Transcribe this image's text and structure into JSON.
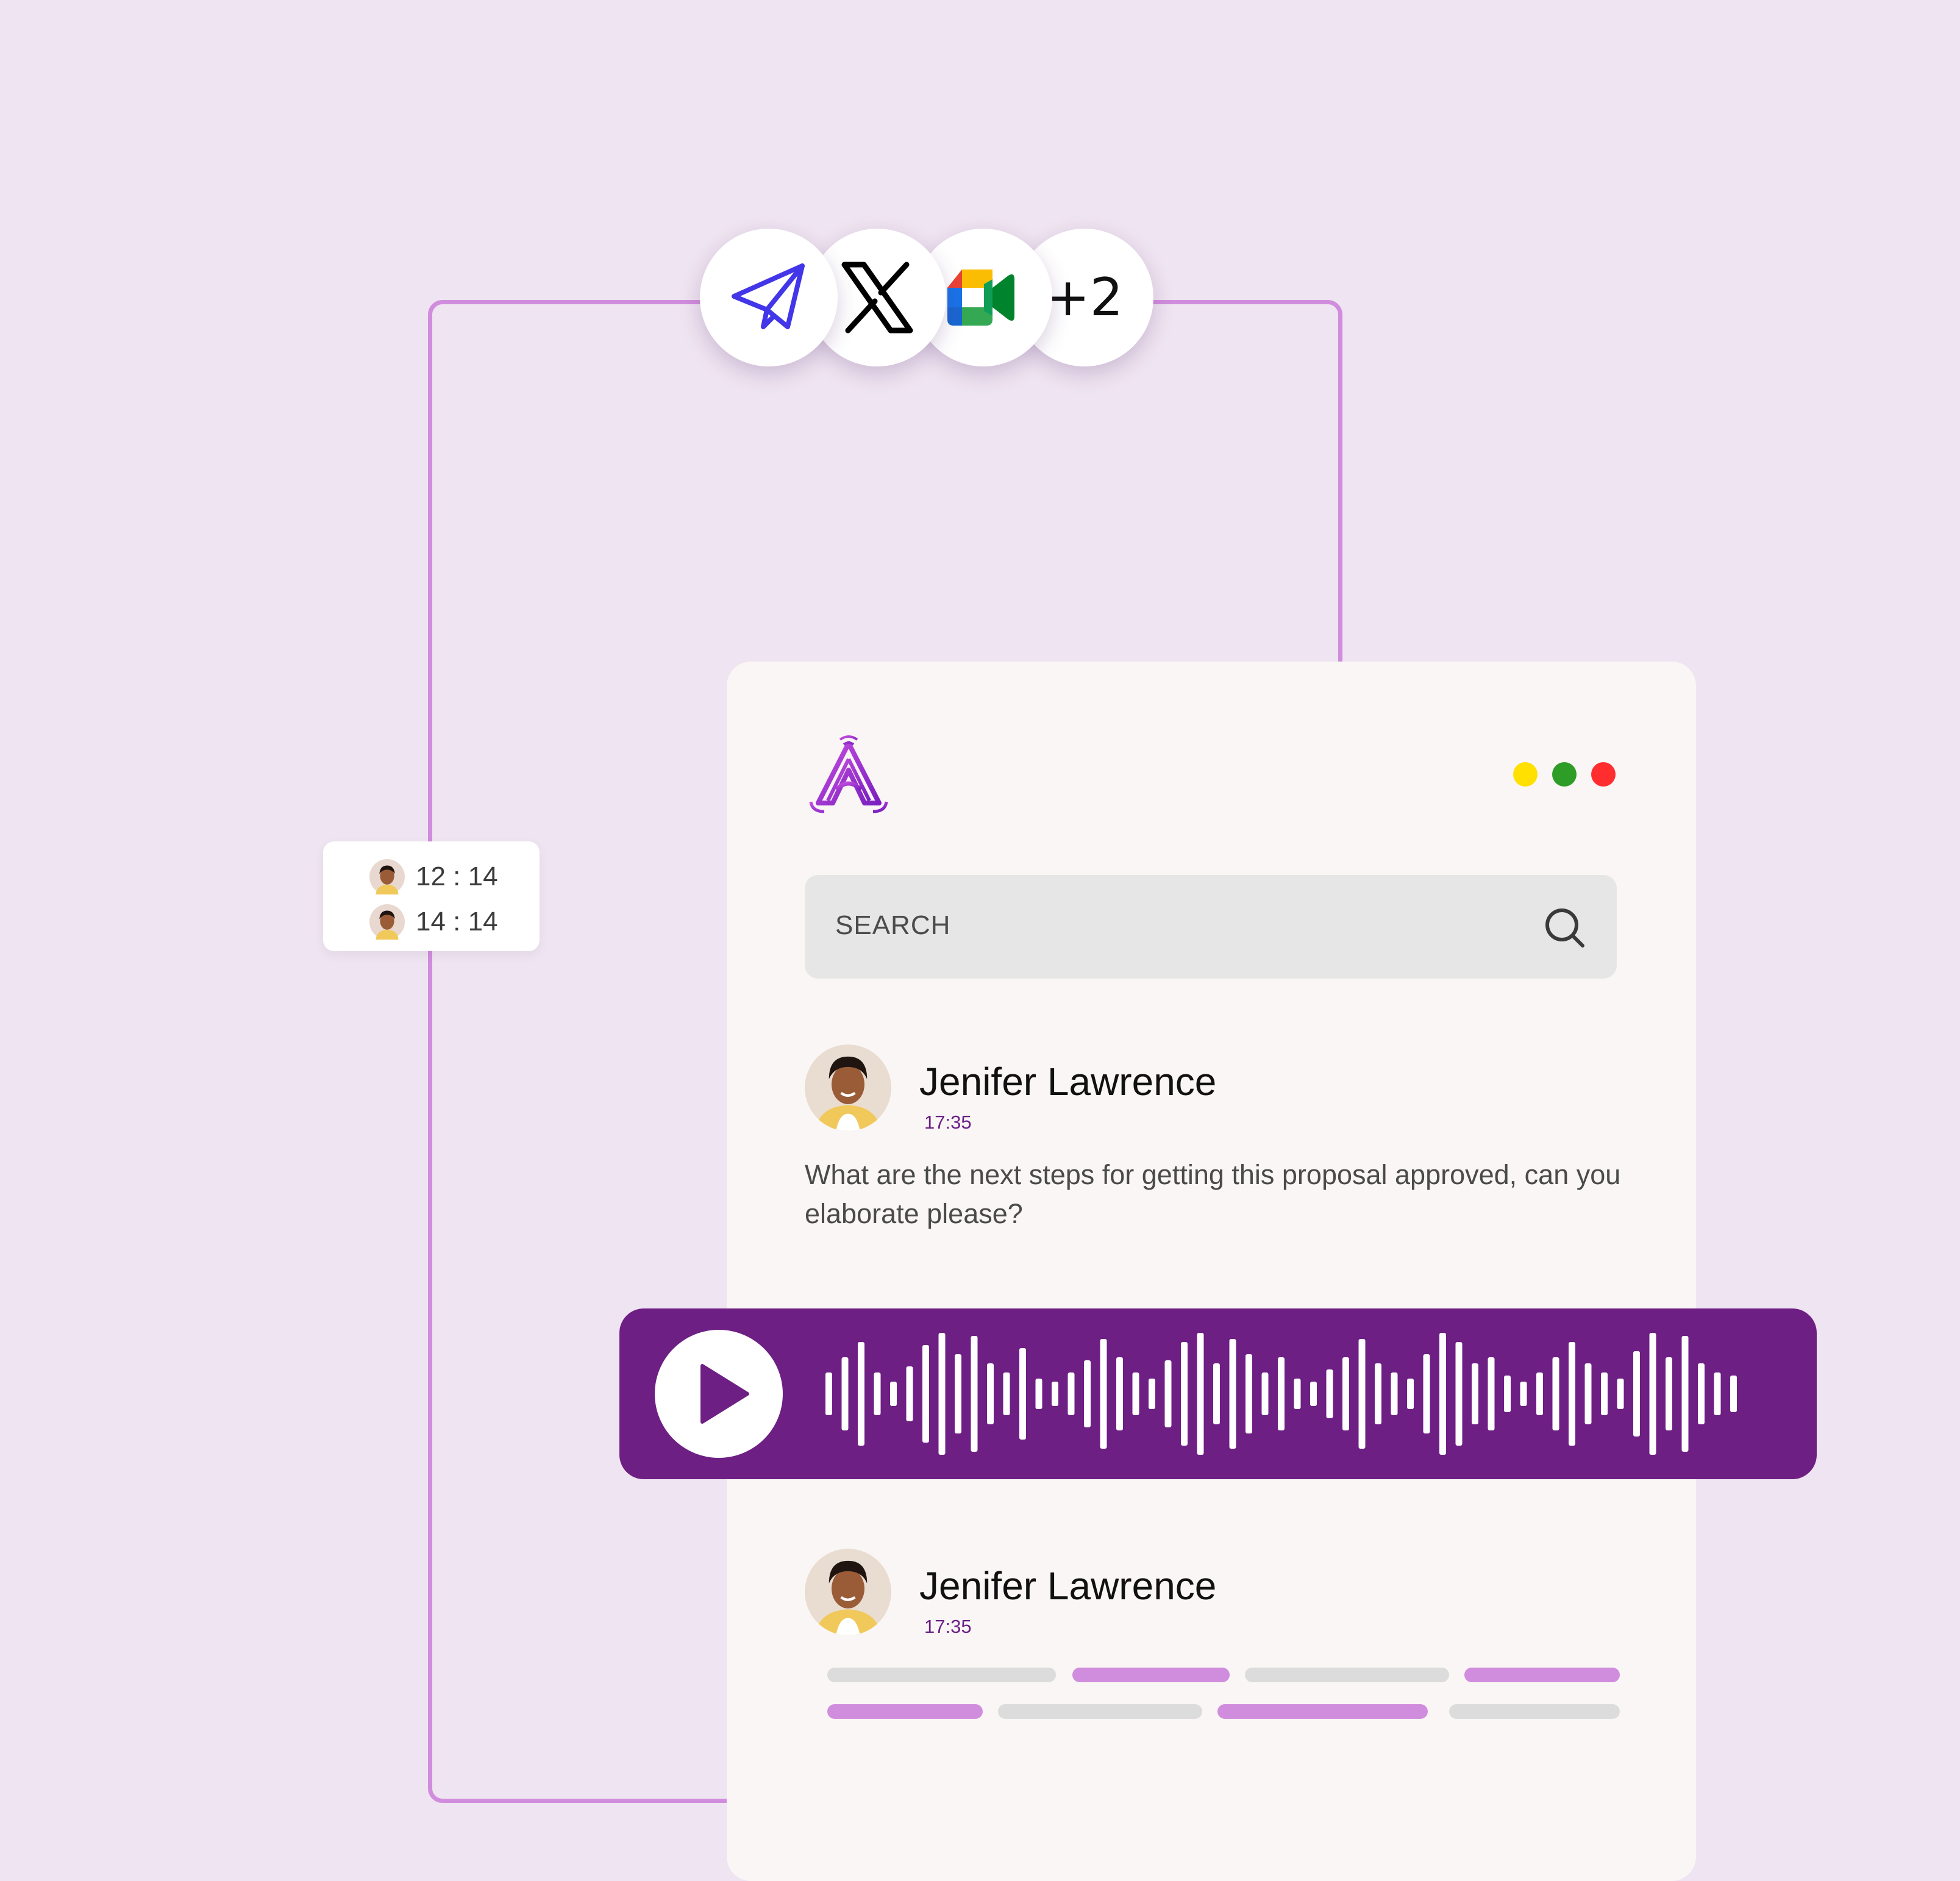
{
  "integrations": {
    "icons": [
      "telegram-send-icon",
      "x-logo-icon",
      "google-meet-icon"
    ],
    "more_count": "+2"
  },
  "timer_card": {
    "rows": [
      {
        "time": "12 : 14"
      },
      {
        "time": "14 : 14"
      }
    ]
  },
  "window": {
    "logo": "app-logo-icon",
    "dots": [
      "#ffe000",
      "#2e9d27",
      "#ff2d2d"
    ]
  },
  "search": {
    "label": "SEARCH",
    "icon": "search-icon"
  },
  "messages": [
    {
      "name": "Jenifer Lawrence",
      "time": "17:35",
      "text": "What are the next steps for getting this proposal approved, can you elaborate please?"
    },
    {
      "name": "Jenifer Lawrence",
      "time": "17:35",
      "text": ""
    }
  ],
  "audio_player": {
    "play_icon": "play-icon",
    "waveform_levels": [
      0.35,
      0.6,
      0.85,
      0.35,
      0.2,
      0.45,
      0.8,
      1.0,
      0.65,
      0.95,
      0.5,
      0.35,
      0.75,
      0.25,
      0.2,
      0.35,
      0.55,
      0.9,
      0.6,
      0.35,
      0.25,
      0.55,
      0.85,
      1.0,
      0.5,
      0.9,
      0.65,
      0.35,
      0.6,
      0.25,
      0.2,
      0.4,
      0.6,
      0.9,
      0.5,
      0.35,
      0.25,
      0.65,
      1.0,
      0.85,
      0.5,
      0.6,
      0.3,
      0.2,
      0.35,
      0.6,
      0.85,
      0.5,
      0.35,
      0.25,
      0.7,
      1.0,
      0.6,
      0.95,
      0.5,
      0.35,
      0.3
    ]
  },
  "colors": {
    "background": "#efe4f1",
    "accent_purple": "#6d1f84",
    "connector": "#d18ddd",
    "placeholder_gray": "#dcdcdc",
    "placeholder_purple": "#d18ddd"
  }
}
